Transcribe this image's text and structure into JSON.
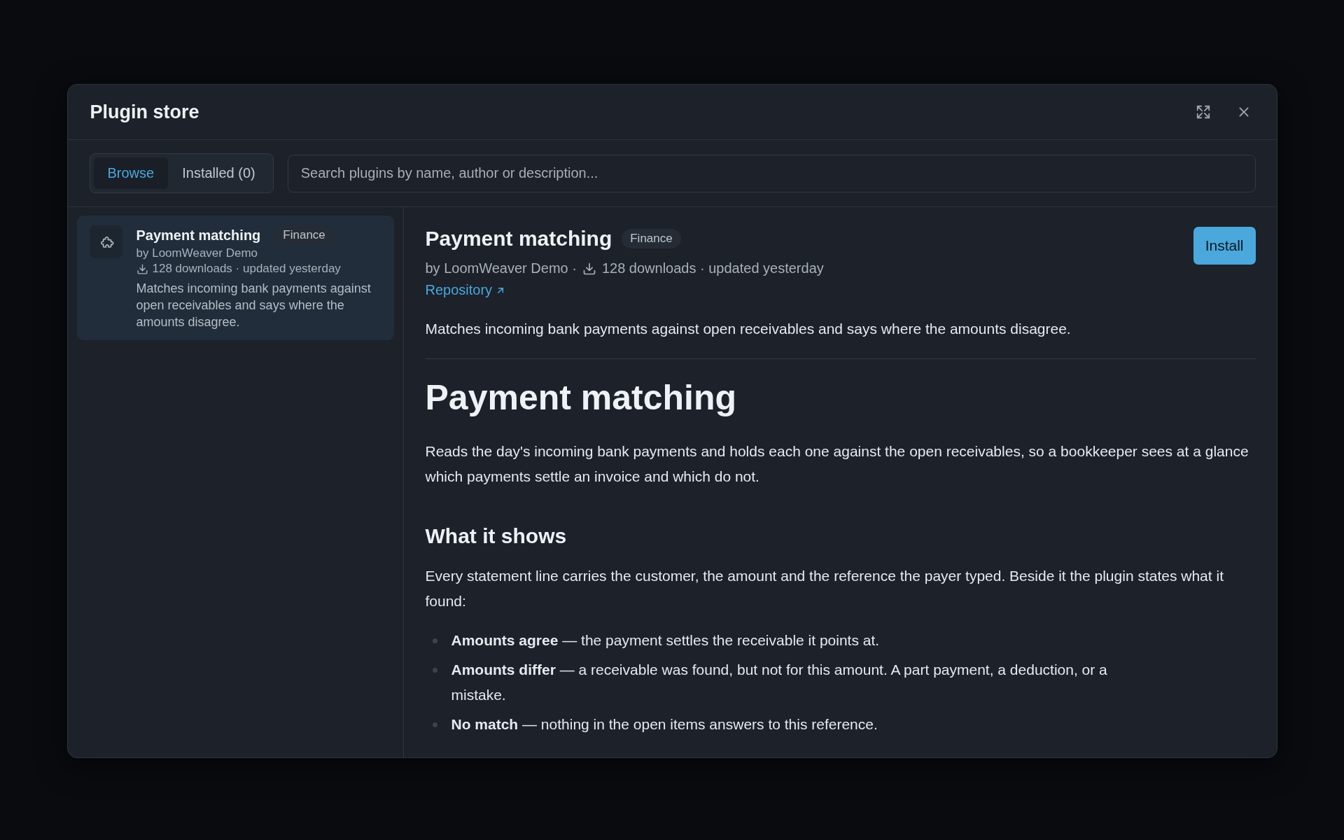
{
  "dialog": {
    "title": "Plugin store"
  },
  "tabs": [
    {
      "label": "Browse",
      "selected": true
    },
    {
      "label": "Installed (0)",
      "selected": false
    }
  ],
  "search": {
    "placeholder": "Search plugins by name, author or description..."
  },
  "plugins": [
    {
      "name": "Payment matching",
      "category": "Finance",
      "author": "by LoomWeaver Demo",
      "stats": "128 downloads · updated yesterday",
      "description": "Matches incoming bank payments against open receivables and says where the amounts disagree.",
      "selected": true
    }
  ],
  "detail": {
    "name": "Payment matching",
    "category": "Finance",
    "author": "by LoomWeaver Demo ·",
    "stats": "128 downloads · updated yesterday",
    "repository": "Repository",
    "install": "Install",
    "summary": "Matches incoming bank payments against open receivables and says where the amounts disagree.",
    "heading": "Payment matching",
    "intro": "Reads the day's incoming bank payments and holds each one against the open receivables, so a bookkeeper sees at a glance which payments settle an invoice and which do not.",
    "subheading": "What it shows",
    "paragraph": "Every statement line carries the customer, the amount and the reference the payer typed. Beside it the plugin states what it found:",
    "bullets": [
      "**Amounts agree** — the payment settles the receivable it points at.",
      "**Amounts differ** — a receivable was found, but not for this amount. A part payment, a deduction, or a mistake.",
      "**No match** — nothing in the open items answers to this reference."
    ]
  }
}
